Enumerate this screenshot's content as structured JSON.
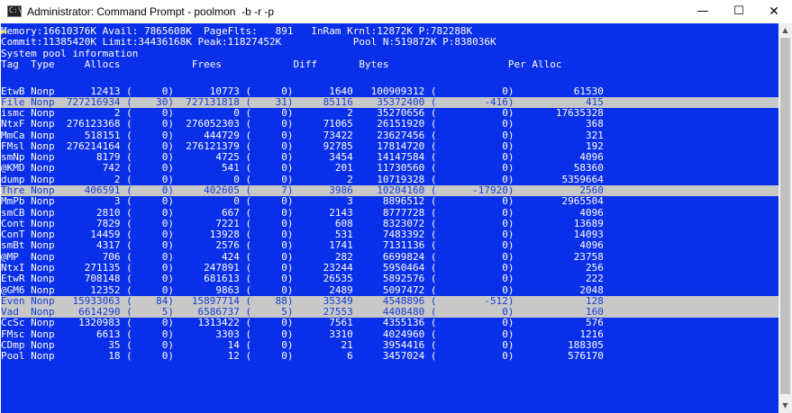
{
  "window": {
    "title": "Administrator: Command Prompt - poolmon  -b -r -p",
    "icon_label": "C:\\",
    "minimize_glyph": "—",
    "maximize_glyph": "☐",
    "close_glyph": "✕"
  },
  "console": {
    "header_lines": [
      "Memory:16610376K Avail: 7865608K  PageFlts:   891   InRam Krnl:12872K P:782288K",
      "Commit:11385420K Limit:34436168K Peak:11827452K            Pool N:519872K P:838036K",
      "System pool information",
      "Tag  Type     Allocs            Frees            Diff       Bytes                    Per Alloc"
    ],
    "rows": [
      {
        "text": "EtwB Nonp      12413 (     0)      10773 (     0)      1640   100909312 (           0)          61530",
        "highlight": false
      },
      {
        "text": "File Nonp  727216934 (    30)  727131818 (    31)     85116    35372400 (        -416)            415",
        "highlight": true
      },
      {
        "text": "ismc Nonp          2 (     0)          0 (     0)         2    35270656 (           0)       17635328",
        "highlight": false
      },
      {
        "text": "NtxF Nonp  276123368 (     0)  276052303 (     0)     71065    26151920 (           0)            368",
        "highlight": false
      },
      {
        "text": "MmCa Nonp     518151 (     0)     444729 (     0)     73422    23627456 (           0)            321",
        "highlight": false
      },
      {
        "text": "FMsl Nonp  276214164 (     0)  276121379 (     0)     92785    17814720 (           0)            192",
        "highlight": false
      },
      {
        "text": "smNp Nonp       8179 (     0)       4725 (     0)      3454    14147584 (           0)           4096",
        "highlight": false
      },
      {
        "text": "@KMD Nonp        742 (     0)        541 (     0)       201    11730560 (           0)          58360",
        "highlight": false
      },
      {
        "text": "dump Nonp          2 (     0)          0 (     0)         2    10719328 (           0)        5359664",
        "highlight": false
      },
      {
        "text": "Thre Nonp     406591 (     0)     402605 (     7)      3986    10204160 (      -17920)           2560",
        "highlight": true
      },
      {
        "text": "MmPb Nonp          3 (     0)          0 (     0)         3     8896512 (           0)        2965504",
        "highlight": false
      },
      {
        "text": "smCB Nonp       2810 (     0)        667 (     0)      2143     8777728 (           0)           4096",
        "highlight": false
      },
      {
        "text": "Cont Nonp       7829 (     0)       7221 (     0)       608     8323072 (           0)          13689",
        "highlight": false
      },
      {
        "text": "ConT Nonp      14459 (     0)      13928 (     0)       531     7483392 (           0)          14093",
        "highlight": false
      },
      {
        "text": "smBt Nonp       4317 (     0)       2576 (     0)      1741     7131136 (           0)           4096",
        "highlight": false
      },
      {
        "text": "@MP  Nonp        706 (     0)        424 (     0)       282     6699824 (           0)          23758",
        "highlight": false
      },
      {
        "text": "NtxI Nonp     271135 (     0)     247891 (     0)     23244     5950464 (           0)            256",
        "highlight": false
      },
      {
        "text": "EtwR Nonp     708148 (     0)     681613 (     0)     26535     5892576 (           0)            222",
        "highlight": false
      },
      {
        "text": "@GM6 Nonp      12352 (     0)       9863 (     0)      2489     5097472 (           0)           2048",
        "highlight": false
      },
      {
        "text": "Even Nonp   15933063 (    84)   15897714 (    88)     35349     4548896 (        -512)            128",
        "highlight": true
      },
      {
        "text": "Vad  Nonp    6614290 (     5)    6586737 (     5)     27553     4408480 (           0)            160",
        "highlight": true
      },
      {
        "text": "CcSc Nonp    1320983 (     0)    1313422 (     0)      7561     4355136 (           0)            576",
        "highlight": false
      },
      {
        "text": "FMsc Nonp       6613 (     0)       3303 (     0)      3310     4024960 (           0)           1216",
        "highlight": false
      },
      {
        "text": "CDmp Nonp         35 (     0)         14 (     0)        21     3954416 (           0)         188305",
        "highlight": false
      },
      {
        "text": "Pool Nonp         18 (     0)         12 (     0)         6     3457024 (           0)         576170",
        "highlight": false
      }
    ]
  },
  "scrollbar": {
    "up_glyph": "▲",
    "down_glyph": "▼"
  }
}
